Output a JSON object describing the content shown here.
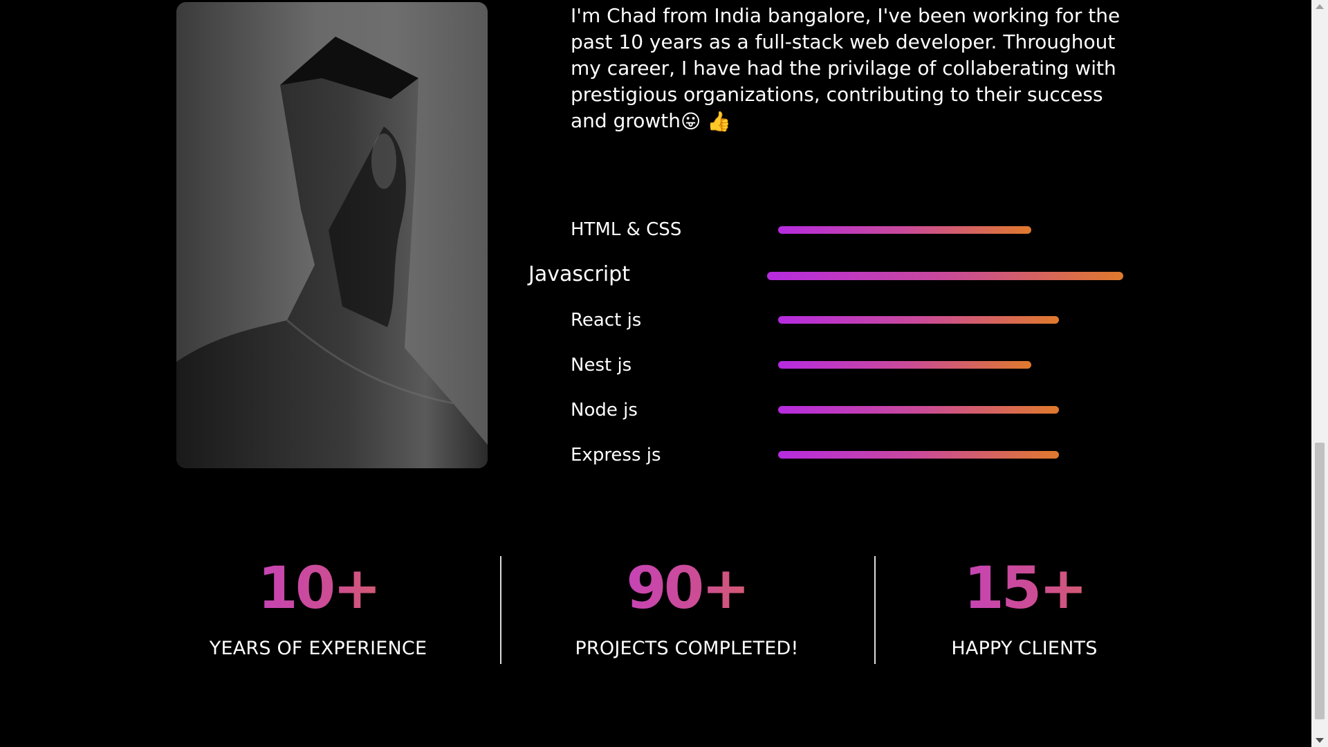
{
  "about": {
    "photo_alt": "profile-photo",
    "bio": "I'm Chad from India bangalore, I've been working for the past 10 years as a full-stack web developer. Throughout my career, I have had the privilage of collaberating with prestigious organizations, contributing to their success and growth",
    "bio_emojis": [
      "😛",
      "👍"
    ]
  },
  "skills": [
    {
      "label": "HTML & CSS",
      "level": 0.72
    },
    {
      "label": "Javascript",
      "level": 1.0
    },
    {
      "label": "React js",
      "level": 0.8
    },
    {
      "label": "Nest js",
      "level": 0.72
    },
    {
      "label": "Node js",
      "level": 0.8
    },
    {
      "label": "Express js",
      "level": 0.8
    }
  ],
  "stats": [
    {
      "number": "10+",
      "label": "YEARS OF EXPERIENCE"
    },
    {
      "number": "90+",
      "label": "PROJECTS COMPLETED!"
    },
    {
      "number": "15+",
      "label": "HAPPY CLIENTS"
    }
  ],
  "colors": {
    "background": "#000000",
    "gradient_start": "#b62be0",
    "gradient_end": "#e07a2c"
  }
}
